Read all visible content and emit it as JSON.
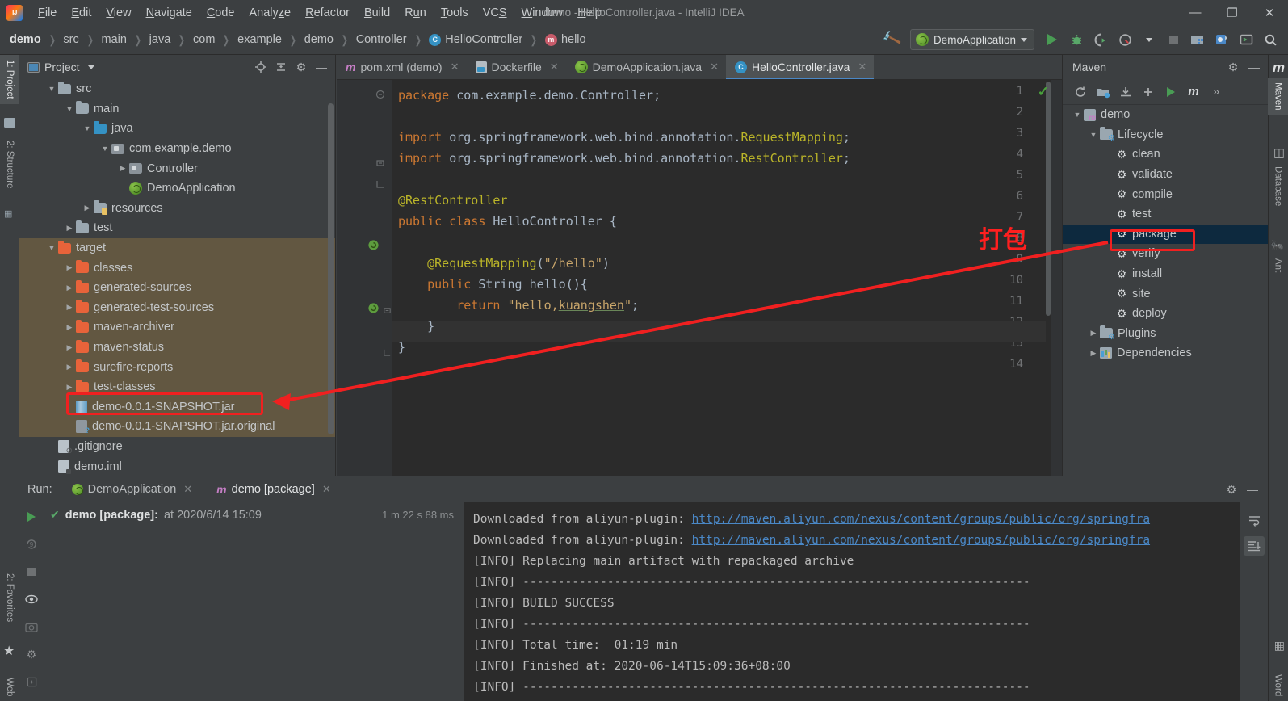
{
  "window": {
    "title": "demo - HelloController.java - IntelliJ IDEA",
    "minimize": "—",
    "maximize": "❐",
    "close": "✕"
  },
  "menu": [
    {
      "label": "File"
    },
    {
      "label": "Edit"
    },
    {
      "label": "View"
    },
    {
      "label": "Navigate"
    },
    {
      "label": "Code"
    },
    {
      "label": "Analyze"
    },
    {
      "label": "Refactor"
    },
    {
      "label": "Build"
    },
    {
      "label": "Run"
    },
    {
      "label": "Tools"
    },
    {
      "label": "VCS"
    },
    {
      "label": "Window"
    },
    {
      "label": "Help"
    }
  ],
  "breadcrumbs": [
    {
      "label": "demo",
      "icon": "none"
    },
    {
      "label": "src",
      "icon": "none"
    },
    {
      "label": "main",
      "icon": "none"
    },
    {
      "label": "java",
      "icon": "none"
    },
    {
      "label": "com",
      "icon": "none"
    },
    {
      "label": "example",
      "icon": "none"
    },
    {
      "label": "demo",
      "icon": "none"
    },
    {
      "label": "Controller",
      "icon": "none"
    },
    {
      "label": "HelloController",
      "icon": "class-icon"
    },
    {
      "label": "hello",
      "icon": "method-icon"
    }
  ],
  "toolbar": {
    "run_config": "DemoApplication",
    "build_icon": "hammer-icon",
    "run_icon": "run-icon",
    "debug_icon": "debug-icon",
    "coverage_icon": "run-with-coverage-icon",
    "profile_icon": "profile-icon",
    "stop_icon": "stop-icon",
    "project_structure_icon": "project-structure-icon",
    "sdk_icon": "sdk-icon",
    "terminal_icon": "terminal-icon",
    "search_icon": "search-everywhere-icon"
  },
  "left_strip": [
    {
      "label": "1: Project",
      "active": true
    },
    {
      "label": "2: Structure",
      "active": false
    },
    {
      "label": "2: Favorites",
      "active": false
    },
    {
      "label": "Web",
      "active": false
    }
  ],
  "right_strip": [
    {
      "label": "Maven",
      "active": true
    },
    {
      "label": "Database",
      "active": false
    },
    {
      "label": "Ant",
      "active": false
    },
    {
      "label": "Word",
      "active": false
    }
  ],
  "project_panel": {
    "title": "Project",
    "icons": [
      "locate-icon",
      "collapse-all-icon",
      "gear-icon",
      "hide-icon"
    ],
    "tree": [
      {
        "label": "src",
        "indent": 1,
        "arrow": "down",
        "icon": "folder-grey",
        "highlight": false
      },
      {
        "label": "main",
        "indent": 2,
        "arrow": "down",
        "icon": "folder-grey",
        "highlight": false
      },
      {
        "label": "java",
        "indent": 3,
        "arrow": "down",
        "icon": "folder-blue",
        "highlight": false
      },
      {
        "label": "com.example.demo",
        "indent": 4,
        "arrow": "down",
        "icon": "package",
        "highlight": false
      },
      {
        "label": "Controller",
        "indent": 5,
        "arrow": "right",
        "icon": "package",
        "highlight": false
      },
      {
        "label": "DemoApplication",
        "indent": 5,
        "arrow": "none",
        "icon": "spring",
        "highlight": false
      },
      {
        "label": "resources",
        "indent": 3,
        "arrow": "right",
        "icon": "folder-res",
        "highlight": false
      },
      {
        "label": "test",
        "indent": 2,
        "arrow": "right",
        "icon": "folder-grey",
        "highlight": false
      },
      {
        "label": "target",
        "indent": 1,
        "arrow": "down",
        "icon": "folder-orange",
        "highlight": true
      },
      {
        "label": "classes",
        "indent": 2,
        "arrow": "right",
        "icon": "folder-orange",
        "highlight": true
      },
      {
        "label": "generated-sources",
        "indent": 2,
        "arrow": "right",
        "icon": "folder-orange",
        "highlight": true
      },
      {
        "label": "generated-test-sources",
        "indent": 2,
        "arrow": "right",
        "icon": "folder-orange",
        "highlight": true
      },
      {
        "label": "maven-archiver",
        "indent": 2,
        "arrow": "right",
        "icon": "folder-orange",
        "highlight": true
      },
      {
        "label": "maven-status",
        "indent": 2,
        "arrow": "right",
        "icon": "folder-orange",
        "highlight": true
      },
      {
        "label": "surefire-reports",
        "indent": 2,
        "arrow": "right",
        "icon": "folder-orange",
        "highlight": true
      },
      {
        "label": "test-classes",
        "indent": 2,
        "arrow": "right",
        "icon": "folder-orange",
        "highlight": true
      },
      {
        "label": "demo-0.0.1-SNAPSHOT.jar",
        "indent": 2,
        "arrow": "none",
        "icon": "jar",
        "highlight": true
      },
      {
        "label": "demo-0.0.1-SNAPSHOT.jar.original",
        "indent": 2,
        "arrow": "none",
        "icon": "jar-original",
        "highlight": true
      },
      {
        "label": ".gitignore",
        "indent": 1,
        "arrow": "none",
        "icon": "gitignore",
        "highlight": false
      },
      {
        "label": "demo.iml",
        "indent": 1,
        "arrow": "none",
        "icon": "iml",
        "highlight": false
      }
    ]
  },
  "editor": {
    "tabs": [
      {
        "label": "pom.xml (demo)",
        "icon": "maven-icon",
        "active": false
      },
      {
        "label": "Dockerfile",
        "icon": "docker-icon",
        "active": false
      },
      {
        "label": "DemoApplication.java",
        "icon": "spring-icon",
        "active": false
      },
      {
        "label": "HelloController.java",
        "icon": "class-icon",
        "active": true
      }
    ],
    "line_numbers": [
      "1",
      "2",
      "3",
      "4",
      "5",
      "6",
      "7",
      "8",
      "9",
      "10",
      "11",
      "12",
      "13",
      "14"
    ],
    "highlighted_line": 11,
    "inspection_status": "ok",
    "code": [
      {
        "n": 1,
        "segments": [
          {
            "t": "package ",
            "c": "k"
          },
          {
            "t": "com.example.demo.Controller",
            "c": "plain"
          },
          {
            "t": ";",
            "c": "plain"
          }
        ]
      },
      {
        "n": 2,
        "segments": []
      },
      {
        "n": 3,
        "segments": [
          {
            "t": "import ",
            "c": "k"
          },
          {
            "t": "org.springframework.web.bind.annotation.",
            "c": "plain"
          },
          {
            "t": "RequestMapping",
            "c": "ann"
          },
          {
            "t": ";",
            "c": "plain"
          }
        ]
      },
      {
        "n": 4,
        "segments": [
          {
            "t": "import ",
            "c": "k"
          },
          {
            "t": "org.springframework.web.bind.annotation.",
            "c": "plain"
          },
          {
            "t": "RestController",
            "c": "ann"
          },
          {
            "t": ";",
            "c": "plain"
          }
        ]
      },
      {
        "n": 5,
        "segments": []
      },
      {
        "n": 6,
        "segments": [
          {
            "t": "@RestController",
            "c": "ann"
          }
        ]
      },
      {
        "n": 7,
        "segments": [
          {
            "t": "public class ",
            "c": "k"
          },
          {
            "t": "HelloController",
            "c": "cls"
          },
          {
            "t": " {",
            "c": "plain"
          }
        ]
      },
      {
        "n": 8,
        "segments": []
      },
      {
        "n": 9,
        "segments": [
          {
            "t": "    @RequestMapping",
            "c": "ann"
          },
          {
            "t": "(",
            "c": "plain"
          },
          {
            "t": "\"/hello\"",
            "c": "str"
          },
          {
            "t": ")",
            "c": "plain"
          }
        ]
      },
      {
        "n": 10,
        "segments": [
          {
            "t": "    public ",
            "c": "k"
          },
          {
            "t": "String ",
            "c": "cls"
          },
          {
            "t": "hello",
            "c": "cls"
          },
          {
            "t": "(){",
            "c": "plain"
          }
        ]
      },
      {
        "n": 11,
        "segments": [
          {
            "t": "        return ",
            "c": "k"
          },
          {
            "t": "\"hello,",
            "c": "str"
          },
          {
            "t": "kuangshen",
            "c": "str under"
          },
          {
            "t": "\"",
            "c": "str"
          },
          {
            "t": ";",
            "c": "plain"
          }
        ]
      },
      {
        "n": 12,
        "segments": [
          {
            "t": "    }",
            "c": "plain"
          }
        ]
      },
      {
        "n": 13,
        "segments": [
          {
            "t": "}",
            "c": "plain"
          }
        ]
      },
      {
        "n": 14,
        "segments": []
      }
    ]
  },
  "maven_panel": {
    "title": "Maven",
    "toolbar": [
      "reload-icon",
      "add-managed-project-icon",
      "download-sources-icon",
      "add-icon",
      "run-icon",
      "execute-maven-goal-icon",
      "more-icon"
    ],
    "tree": [
      {
        "label": "demo",
        "indent": 0,
        "arrow": "down",
        "icon": "maven-project-icon",
        "selected": false
      },
      {
        "label": "Lifecycle",
        "indent": 1,
        "arrow": "down",
        "icon": "lifecycle-icon",
        "selected": false
      },
      {
        "label": "clean",
        "indent": 2,
        "arrow": "none",
        "icon": "goal-icon",
        "selected": false
      },
      {
        "label": "validate",
        "indent": 2,
        "arrow": "none",
        "icon": "goal-icon",
        "selected": false
      },
      {
        "label": "compile",
        "indent": 2,
        "arrow": "none",
        "icon": "goal-icon",
        "selected": false
      },
      {
        "label": "test",
        "indent": 2,
        "arrow": "none",
        "icon": "goal-icon",
        "selected": false
      },
      {
        "label": "package",
        "indent": 2,
        "arrow": "none",
        "icon": "goal-icon",
        "selected": true
      },
      {
        "label": "verify",
        "indent": 2,
        "arrow": "none",
        "icon": "goal-icon",
        "selected": false
      },
      {
        "label": "install",
        "indent": 2,
        "arrow": "none",
        "icon": "goal-icon",
        "selected": false
      },
      {
        "label": "site",
        "indent": 2,
        "arrow": "none",
        "icon": "goal-icon",
        "selected": false
      },
      {
        "label": "deploy",
        "indent": 2,
        "arrow": "none",
        "icon": "goal-icon",
        "selected": false
      },
      {
        "label": "Plugins",
        "indent": 1,
        "arrow": "right",
        "icon": "lifecycle-icon",
        "selected": false
      },
      {
        "label": "Dependencies",
        "indent": 1,
        "arrow": "right",
        "icon": "dependencies-icon",
        "selected": false
      }
    ]
  },
  "run_panel": {
    "label": "Run:",
    "tabs": [
      {
        "label": "DemoApplication",
        "icon": "spring-icon",
        "active": false
      },
      {
        "label": "demo [package]",
        "icon": "maven-icon",
        "active": true
      }
    ],
    "header_icons": [
      "gear-icon",
      "hide-icon"
    ],
    "gutter_icons": [
      "rerun-icon",
      "rerun-failed-icon",
      "stop-icon",
      "toggle-visibility-icon",
      "export-icon",
      "settings-icon",
      "pin-icon"
    ],
    "tree_node": {
      "status": "✔",
      "name": "demo [package]:",
      "at": "at 2020/6/14 15:09",
      "duration": "1 m 22 s 88 ms"
    },
    "console_icons": [
      "soft-wrap-icon",
      "scroll-to-end-icon"
    ],
    "console": [
      {
        "prefix": "Downloaded from aliyun-plugin: ",
        "link": "http://maven.aliyun.com/nexus/content/groups/public/org/springfra"
      },
      {
        "prefix": "Downloaded from aliyun-plugin: ",
        "link": "http://maven.aliyun.com/nexus/content/groups/public/org/springfra"
      },
      {
        "prefix": "[INFO] Replacing main artifact with repackaged archive",
        "link": ""
      },
      {
        "prefix": "[INFO] ------------------------------------------------------------------------",
        "link": ""
      },
      {
        "prefix": "[INFO] BUILD SUCCESS",
        "link": ""
      },
      {
        "prefix": "[INFO] ------------------------------------------------------------------------",
        "link": ""
      },
      {
        "prefix": "[INFO] Total time:  01:19 min",
        "link": ""
      },
      {
        "prefix": "[INFO] Finished at: 2020-06-14T15:09:36+08:00",
        "link": ""
      },
      {
        "prefix": "[INFO] ------------------------------------------------------------------------",
        "link": ""
      }
    ]
  },
  "annotations": {
    "label": "打包",
    "color": "#ff1f1f",
    "box_jar_target": "demo-0.0.1-SNAPSHOT.jar",
    "box_maven_target": "package"
  }
}
